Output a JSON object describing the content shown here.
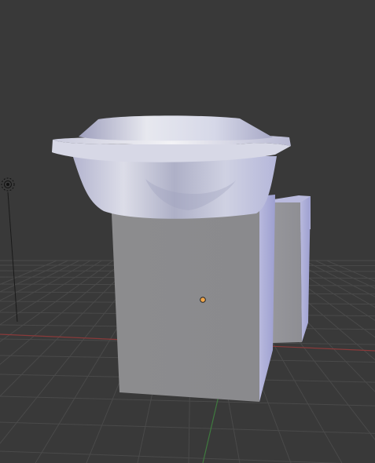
{
  "viewport": {
    "title": "",
    "background_color": "#393939"
  },
  "grid": {
    "line_color": "#4a4a4a",
    "x_axis_color": "#8a3a3a",
    "y_axis_color": "#3f7a3f"
  },
  "model": {
    "material_color": "#d8dae8",
    "shadow_color": "#8c8ea8"
  },
  "origin": {
    "color": "#f0a64a"
  },
  "light": {
    "icon": "lamp-icon"
  }
}
